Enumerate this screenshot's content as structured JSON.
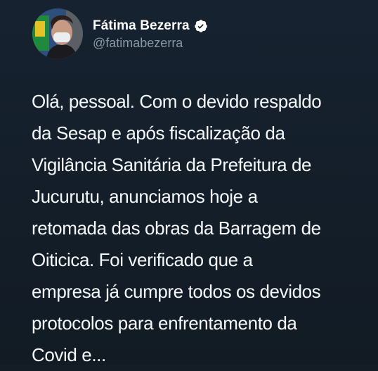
{
  "tweet": {
    "author": {
      "display_name": "Fátima Bezerra",
      "handle": "@fatimabezerra",
      "verified": true,
      "verified_icon": "verified-badge-icon",
      "avatar": "profile-photo"
    },
    "text_lines": [
      "Olá, pessoal. Com o devido respaldo",
      "da Sesap e após fiscalização da",
      "Vigilância Sanitária da Prefeitura de",
      "Jucurutu, anunciamos hoje a",
      "retomada das obras da Barragem de",
      "Oiticica. Foi verificado que a",
      "empresa já cumpre todos os devidos",
      "protocolos para enfrentamento da",
      "Covid e..."
    ]
  },
  "colors": {
    "background": "#141d26",
    "text": "#f5f8fa",
    "secondary_text": "#8899a6",
    "verified_badge": "#ffffff"
  }
}
